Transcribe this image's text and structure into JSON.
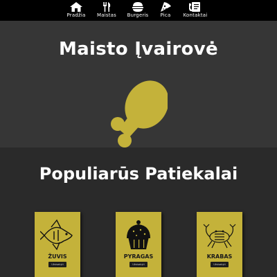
{
  "nav": {
    "items": [
      {
        "label": "Pradžia",
        "icon": "home-icon"
      },
      {
        "label": "Maistas",
        "icon": "cutlery-icon"
      },
      {
        "label": "Burgeris",
        "icon": "burger-icon"
      },
      {
        "label": "Pica",
        "icon": "pizza-icon"
      },
      {
        "label": "Kontaktai",
        "icon": "contact-icon"
      }
    ]
  },
  "hero": {
    "title": "Maisto Įvairovė",
    "icon": "drumstick-icon"
  },
  "popular": {
    "title": "Populiarūs Patiekalai",
    "cards": [
      {
        "name": "ŽUVIS",
        "button": "Užsisakyti",
        "icon": "fish-icon"
      },
      {
        "name": "PYRAGAS",
        "button": "Užsisakyti",
        "icon": "cupcake-icon"
      },
      {
        "name": "KRABAS",
        "button": "Užsisakyti",
        "icon": "crab-icon"
      }
    ]
  },
  "colors": {
    "navbar": "#000000",
    "hero_bg": "#363636",
    "section_bg": "#2a2a2a",
    "accent": "#c4b23a",
    "text": "#ffffff"
  }
}
